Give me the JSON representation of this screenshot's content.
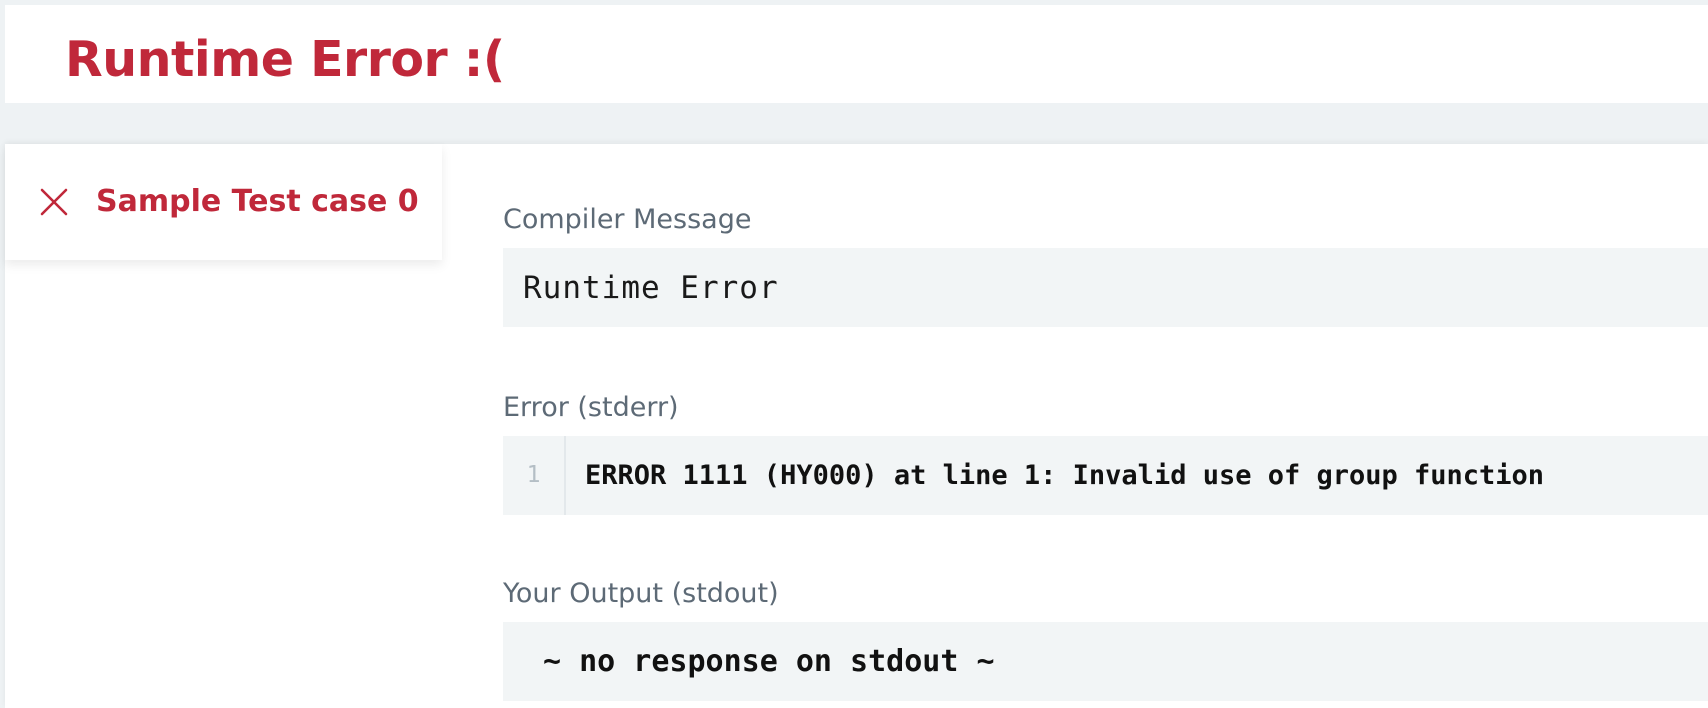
{
  "header": {
    "title": "Runtime Error :("
  },
  "testcase_tab": {
    "label": "Sample Test case 0",
    "status_icon": "close-icon",
    "status_color": "#c0283a"
  },
  "compiler_message": {
    "label": "Compiler Message",
    "value": "Runtime Error"
  },
  "stderr": {
    "label": "Error (stderr)",
    "line_number": "1",
    "value": "ERROR 1111 (HY000) at line 1: Invalid use of group function"
  },
  "stdout": {
    "label": "Your Output (stdout)",
    "value": "~ no response on stdout ~"
  },
  "colors": {
    "error_red": "#c0283a",
    "code_background": "#f2f5f6",
    "label_gray": "#5d6a76"
  }
}
